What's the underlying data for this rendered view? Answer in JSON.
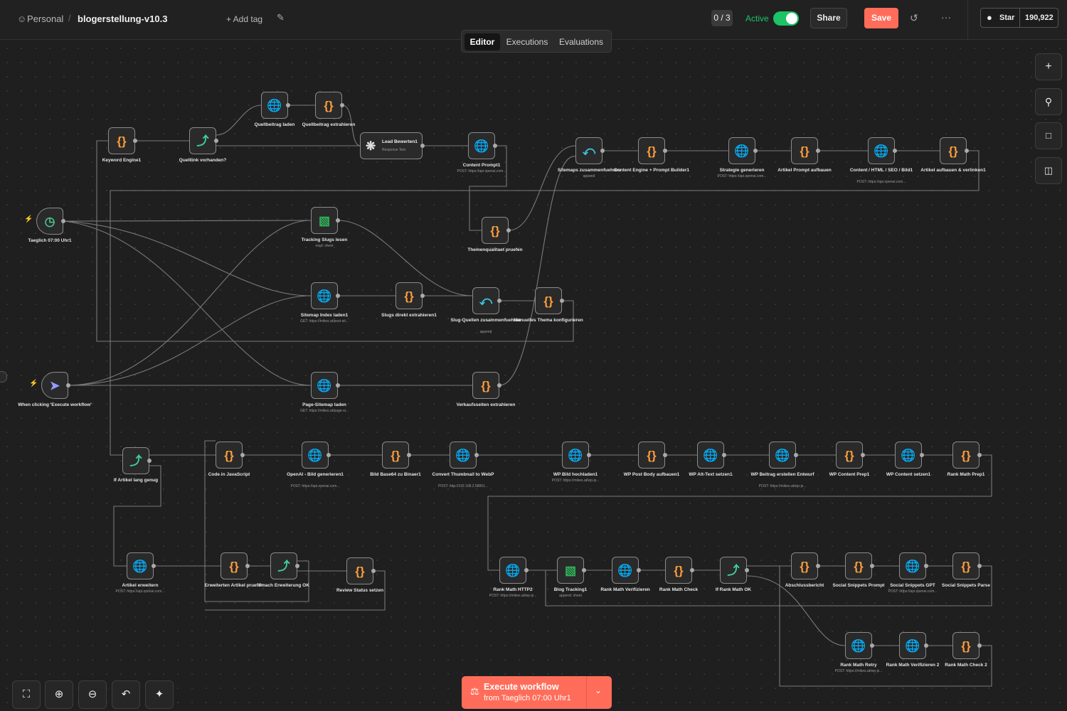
{
  "header": {
    "breadcrumb_project": "Personal",
    "workflow_name": "blogerstellung-v10.3",
    "add_tag": "+ Add tag",
    "counter": "0 / 3",
    "active_label": "Active",
    "share": "Share",
    "save": "Save",
    "star": "Star",
    "star_count": "190,922"
  },
  "tabs": [
    "Editor",
    "Executions",
    "Evaluations"
  ],
  "execute": {
    "title": "Execute workflow",
    "subtitle": "from Taeglich 07:00 Uhr1"
  },
  "colors": {
    "save": "#ff6d5a",
    "active_toggle": "#1cc465",
    "execute": "#ff6d5a"
  },
  "nodes": [
    {
      "id": "keyword",
      "type": "code",
      "label": "Keyword Engine1",
      "sub": ""
    },
    {
      "id": "quelllink",
      "type": "if",
      "label": "Quelllink vorhanden?",
      "sub": ""
    },
    {
      "id": "quellbeitrag",
      "type": "http",
      "label": "Quellbeitrag laden",
      "sub": ""
    },
    {
      "id": "quellextr",
      "type": "code",
      "label": "Quellbeitrag extrahieren",
      "sub": ""
    },
    {
      "id": "lead",
      "type": "ai",
      "label": "Lead Bewerten1",
      "sub": "Response Text"
    },
    {
      "id": "contentprompt",
      "type": "http",
      "label": "Content Prompt1",
      "sub": "POST: https://api.openai.com..."
    },
    {
      "id": "sitemaps",
      "type": "merge",
      "label": "Sitemaps zusammenfuehren",
      "sub": "append"
    },
    {
      "id": "contentengine",
      "type": "code",
      "label": "Content Engine + Prompt Builder1",
      "sub": ""
    },
    {
      "id": "strategie",
      "type": "http",
      "label": "Strategie generieren",
      "sub": "POST: https://api.openai.com..."
    },
    {
      "id": "artikelprompt",
      "type": "code",
      "label": "Artikel Prompt aufbauen",
      "sub": ""
    },
    {
      "id": "contenthtml",
      "type": "http",
      "label": "Content / HTML / SEO / Bild1",
      "sub": "POST: https://api.openai.com..."
    },
    {
      "id": "artikelaufbauen",
      "type": "code",
      "label": "Artikel aufbauen & verlinken1",
      "sub": ""
    },
    {
      "id": "taeglich",
      "type": "trigger",
      "label": "Taeglich 07:00 Uhr1",
      "sub": ""
    },
    {
      "id": "tracking",
      "type": "sheet",
      "label": "Tracking Slugs lesen",
      "sub": "read: sheet"
    },
    {
      "id": "themen",
      "type": "code",
      "label": "Themenqualitaet pruefen",
      "sub": ""
    },
    {
      "id": "sitemapindex",
      "type": "http",
      "label": "Sitemap Index laden1",
      "sub": "GET: https://mikes.at/post-sit..."
    },
    {
      "id": "slugsdirekt",
      "type": "code",
      "label": "Slugs direkt extrahieren1",
      "sub": ""
    },
    {
      "id": "slugquellen",
      "type": "merge",
      "label": "Slug-Quellen zusammenfuehren",
      "sub": "append"
    },
    {
      "id": "manuell",
      "type": "code",
      "label": "Manuelles Thema konfigurieren",
      "sub": ""
    },
    {
      "id": "clicking",
      "type": "manual",
      "label": "When clicking 'Execute workflow'",
      "sub": ""
    },
    {
      "id": "pagesitemap",
      "type": "http",
      "label": "Page-Sitemap laden",
      "sub": "GET: https://mikes.at/page-si..."
    },
    {
      "id": "verkauf",
      "type": "code",
      "label": "Verkaufsseiten extrahieren",
      "sub": ""
    },
    {
      "id": "iflang",
      "type": "if",
      "label": "If Artikel lang genug",
      "sub": ""
    },
    {
      "id": "codejs",
      "type": "code",
      "label": "Code in JavaScript",
      "sub": ""
    },
    {
      "id": "openaibild",
      "type": "http",
      "label": "OpenAI - Bild generieren1",
      "sub": "POST: https://api.openai.com..."
    },
    {
      "id": "bildbase",
      "type": "code",
      "label": "Bild Base64 zu Binaer1",
      "sub": ""
    },
    {
      "id": "convert",
      "type": "http",
      "label": "Convert Thumbnail to WebP",
      "sub": "POST: http://192.168.2.58001..."
    },
    {
      "id": "wpbild",
      "type": "http",
      "label": "WP Bild hochladen1",
      "sub": "POST: https://mikes.at/wp-js..."
    },
    {
      "id": "wppost",
      "type": "code",
      "label": "WP Post Body aufbauen1",
      "sub": ""
    },
    {
      "id": "wpalt",
      "type": "http",
      "label": "WP Alt-Text setzen1",
      "sub": ""
    },
    {
      "id": "wpbeitrag",
      "type": "http",
      "label": "WP Beitrag erstellen Entwurf",
      "sub": "POST: https://mikes.at/wp-js..."
    },
    {
      "id": "wpcontentprep",
      "type": "code",
      "label": "WP Content Prep1",
      "sub": ""
    },
    {
      "id": "wpcontentset",
      "type": "http",
      "label": "WP Content setzen1",
      "sub": ""
    },
    {
      "id": "rankprep",
      "type": "code",
      "label": "Rank Math Prep1",
      "sub": ""
    },
    {
      "id": "artikelerw",
      "type": "http",
      "label": "Artikel erweitern",
      "sub": "POST: https://api.openai.com..."
    },
    {
      "id": "erwpruefen",
      "type": "code",
      "label": "Erweiterten Artikel pruefen",
      "sub": ""
    },
    {
      "id": "ifnach",
      "type": "if",
      "label": "If nach Erweiterung OK",
      "sub": ""
    },
    {
      "id": "review",
      "type": "code",
      "label": "Review Status setzen",
      "sub": ""
    },
    {
      "id": "rankhttp",
      "type": "http",
      "label": "Rank Math HTTP2",
      "sub": "POST: https://mikes.at/wp-js..."
    },
    {
      "id": "blogtrack",
      "type": "sheet",
      "label": "Blog Tracking1",
      "sub": "append: sheet"
    },
    {
      "id": "rankverif",
      "type": "http",
      "label": "Rank Math Verifizieren",
      "sub": ""
    },
    {
      "id": "rankcheck",
      "type": "code",
      "label": "Rank Math Check",
      "sub": ""
    },
    {
      "id": "ifrank",
      "type": "if",
      "label": "If Rank Math OK",
      "sub": ""
    },
    {
      "id": "abschluss",
      "type": "code",
      "label": "Abschlussbericht",
      "sub": ""
    },
    {
      "id": "socialprompt",
      "type": "code",
      "label": "Social Snippets Prompt",
      "sub": ""
    },
    {
      "id": "socialgpt",
      "type": "http",
      "label": "Social Snippets GPT",
      "sub": "POST: https://api.openai.com..."
    },
    {
      "id": "socialparse",
      "type": "code",
      "label": "Social Snippets Parse",
      "sub": ""
    },
    {
      "id": "rankretry",
      "type": "http",
      "label": "Rank Math Retry",
      "sub": "POST: https://mikes.at/wp-js..."
    },
    {
      "id": "rankverif2",
      "type": "http",
      "label": "Rank Math Verifizieren 2",
      "sub": ""
    },
    {
      "id": "rankcheck2",
      "type": "code",
      "label": "Rank Math Check 2",
      "sub": ""
    }
  ]
}
